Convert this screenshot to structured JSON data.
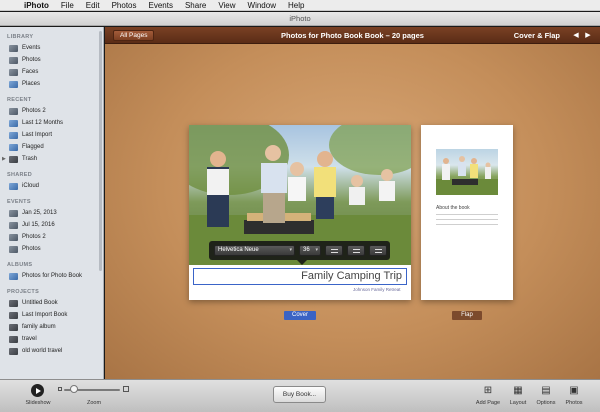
{
  "menubar": {
    "apple_icon": "apple-icon",
    "app_name": "iPhoto",
    "items": [
      "File",
      "Edit",
      "Photos",
      "Events",
      "Share",
      "View",
      "Window",
      "Help"
    ]
  },
  "window": {
    "title": "iPhoto"
  },
  "sidebar": {
    "library": {
      "heading": "LIBRARY",
      "items": [
        "Events",
        "Photos",
        "Faces",
        "Places"
      ]
    },
    "recent": {
      "heading": "RECENT",
      "items": [
        "Photos 2",
        "Last 12 Months",
        "Last Import",
        "Flagged",
        "Trash"
      ]
    },
    "shared": {
      "heading": "SHARED",
      "items": [
        "iCloud"
      ]
    },
    "events": {
      "heading": "EVENTS",
      "items": [
        "Jan 25, 2013",
        "Jul 15, 2016",
        "Photos 2",
        "Photos"
      ]
    },
    "albums": {
      "heading": "ALBUMS",
      "items": [
        "Photos for Photo Book"
      ]
    },
    "projects": {
      "heading": "PROJECTS",
      "items": [
        "Untitled Book",
        "Last Import Book",
        "family album",
        "travel",
        "old world travel"
      ]
    }
  },
  "main": {
    "all_pages": "All Pages",
    "title": "Photos for Photo Book Book – 20 pages",
    "cover_flap": "Cover & Flap",
    "prev_arrow": "◀",
    "next_arrow": "▶"
  },
  "hud": {
    "font": "Helvetica Neue",
    "size": "36"
  },
  "cover": {
    "title": "Family Camping Trip",
    "subtitle": "Johnson Family Retreat",
    "label": "Cover"
  },
  "flap": {
    "heading": "About the book",
    "label": "Flap"
  },
  "toolbar": {
    "slideshow": "Slideshow",
    "zoom": "Zoom",
    "buy_book": "Buy Book...",
    "add_page": "Add Page",
    "layout": "Layout",
    "options": "Options",
    "photos": "Photos"
  },
  "colors": {
    "header_bg": "#5a2c16",
    "selection_blue": "#3b63c4",
    "wood": "#c48e5a"
  }
}
